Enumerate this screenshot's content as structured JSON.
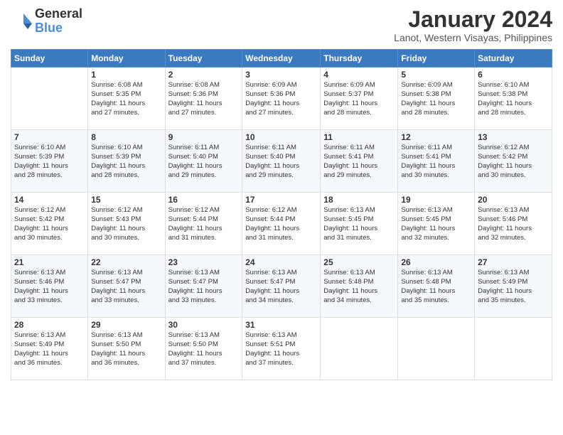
{
  "logo": {
    "general": "General",
    "blue": "Blue"
  },
  "title": "January 2024",
  "location": "Lanot, Western Visayas, Philippines",
  "days_header": [
    "Sunday",
    "Monday",
    "Tuesday",
    "Wednesday",
    "Thursday",
    "Friday",
    "Saturday"
  ],
  "weeks": [
    [
      {
        "num": "",
        "info": ""
      },
      {
        "num": "1",
        "info": "Sunrise: 6:08 AM\nSunset: 5:35 PM\nDaylight: 11 hours\nand 27 minutes."
      },
      {
        "num": "2",
        "info": "Sunrise: 6:08 AM\nSunset: 5:36 PM\nDaylight: 11 hours\nand 27 minutes."
      },
      {
        "num": "3",
        "info": "Sunrise: 6:09 AM\nSunset: 5:36 PM\nDaylight: 11 hours\nand 27 minutes."
      },
      {
        "num": "4",
        "info": "Sunrise: 6:09 AM\nSunset: 5:37 PM\nDaylight: 11 hours\nand 28 minutes."
      },
      {
        "num": "5",
        "info": "Sunrise: 6:09 AM\nSunset: 5:38 PM\nDaylight: 11 hours\nand 28 minutes."
      },
      {
        "num": "6",
        "info": "Sunrise: 6:10 AM\nSunset: 5:38 PM\nDaylight: 11 hours\nand 28 minutes."
      }
    ],
    [
      {
        "num": "7",
        "info": "Sunrise: 6:10 AM\nSunset: 5:39 PM\nDaylight: 11 hours\nand 28 minutes."
      },
      {
        "num": "8",
        "info": "Sunrise: 6:10 AM\nSunset: 5:39 PM\nDaylight: 11 hours\nand 28 minutes."
      },
      {
        "num": "9",
        "info": "Sunrise: 6:11 AM\nSunset: 5:40 PM\nDaylight: 11 hours\nand 29 minutes."
      },
      {
        "num": "10",
        "info": "Sunrise: 6:11 AM\nSunset: 5:40 PM\nDaylight: 11 hours\nand 29 minutes."
      },
      {
        "num": "11",
        "info": "Sunrise: 6:11 AM\nSunset: 5:41 PM\nDaylight: 11 hours\nand 29 minutes."
      },
      {
        "num": "12",
        "info": "Sunrise: 6:11 AM\nSunset: 5:41 PM\nDaylight: 11 hours\nand 30 minutes."
      },
      {
        "num": "13",
        "info": "Sunrise: 6:12 AM\nSunset: 5:42 PM\nDaylight: 11 hours\nand 30 minutes."
      }
    ],
    [
      {
        "num": "14",
        "info": "Sunrise: 6:12 AM\nSunset: 5:42 PM\nDaylight: 11 hours\nand 30 minutes."
      },
      {
        "num": "15",
        "info": "Sunrise: 6:12 AM\nSunset: 5:43 PM\nDaylight: 11 hours\nand 30 minutes."
      },
      {
        "num": "16",
        "info": "Sunrise: 6:12 AM\nSunset: 5:44 PM\nDaylight: 11 hours\nand 31 minutes."
      },
      {
        "num": "17",
        "info": "Sunrise: 6:12 AM\nSunset: 5:44 PM\nDaylight: 11 hours\nand 31 minutes."
      },
      {
        "num": "18",
        "info": "Sunrise: 6:13 AM\nSunset: 5:45 PM\nDaylight: 11 hours\nand 31 minutes."
      },
      {
        "num": "19",
        "info": "Sunrise: 6:13 AM\nSunset: 5:45 PM\nDaylight: 11 hours\nand 32 minutes."
      },
      {
        "num": "20",
        "info": "Sunrise: 6:13 AM\nSunset: 5:46 PM\nDaylight: 11 hours\nand 32 minutes."
      }
    ],
    [
      {
        "num": "21",
        "info": "Sunrise: 6:13 AM\nSunset: 5:46 PM\nDaylight: 11 hours\nand 33 minutes."
      },
      {
        "num": "22",
        "info": "Sunrise: 6:13 AM\nSunset: 5:47 PM\nDaylight: 11 hours\nand 33 minutes."
      },
      {
        "num": "23",
        "info": "Sunrise: 6:13 AM\nSunset: 5:47 PM\nDaylight: 11 hours\nand 33 minutes."
      },
      {
        "num": "24",
        "info": "Sunrise: 6:13 AM\nSunset: 5:47 PM\nDaylight: 11 hours\nand 34 minutes."
      },
      {
        "num": "25",
        "info": "Sunrise: 6:13 AM\nSunset: 5:48 PM\nDaylight: 11 hours\nand 34 minutes."
      },
      {
        "num": "26",
        "info": "Sunrise: 6:13 AM\nSunset: 5:48 PM\nDaylight: 11 hours\nand 35 minutes."
      },
      {
        "num": "27",
        "info": "Sunrise: 6:13 AM\nSunset: 5:49 PM\nDaylight: 11 hours\nand 35 minutes."
      }
    ],
    [
      {
        "num": "28",
        "info": "Sunrise: 6:13 AM\nSunset: 5:49 PM\nDaylight: 11 hours\nand 36 minutes."
      },
      {
        "num": "29",
        "info": "Sunrise: 6:13 AM\nSunset: 5:50 PM\nDaylight: 11 hours\nand 36 minutes."
      },
      {
        "num": "30",
        "info": "Sunrise: 6:13 AM\nSunset: 5:50 PM\nDaylight: 11 hours\nand 37 minutes."
      },
      {
        "num": "31",
        "info": "Sunrise: 6:13 AM\nSunset: 5:51 PM\nDaylight: 11 hours\nand 37 minutes."
      },
      {
        "num": "",
        "info": ""
      },
      {
        "num": "",
        "info": ""
      },
      {
        "num": "",
        "info": ""
      }
    ]
  ]
}
